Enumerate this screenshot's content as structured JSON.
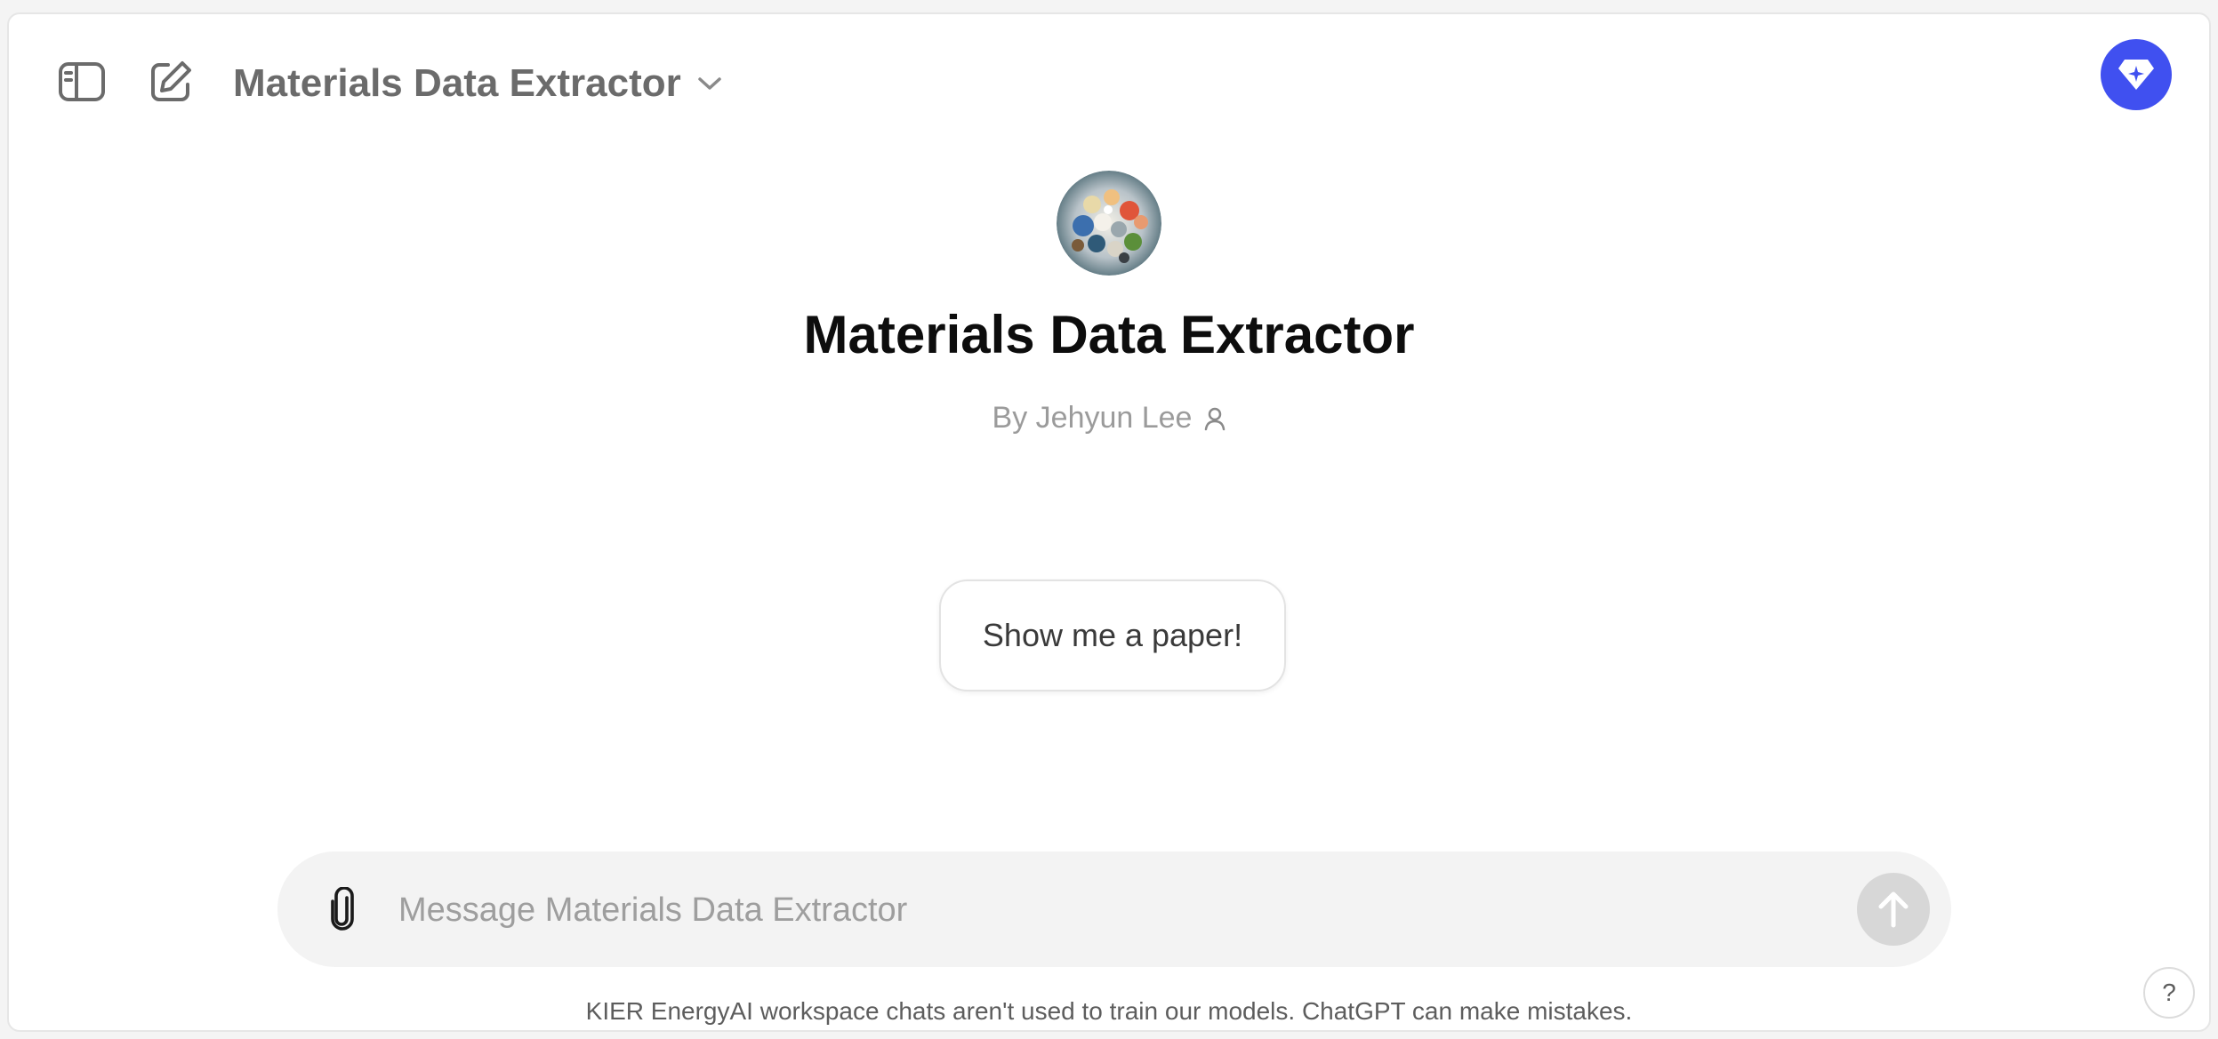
{
  "header": {
    "model_title": "Materials Data Extractor",
    "icons": {
      "sidebar_toggle": "sidebar-toggle-icon",
      "new_chat": "edit-icon",
      "model_dropdown": "chevron-down-icon",
      "profile": "diamond-sparkle-icon"
    }
  },
  "gpt": {
    "name": "Materials Data Extractor",
    "author": "By Jehyun Lee",
    "author_icon": "person-icon"
  },
  "conversation_starters": [
    "Show me a paper!"
  ],
  "composer": {
    "placeholder": "Message Materials Data Extractor",
    "attach_icon": "paperclip-icon",
    "send_icon": "arrow-up-icon"
  },
  "footer": {
    "note": "KIER EnergyAI workspace chats aren't used to train our models. ChatGPT can make mistakes.",
    "help_label": "?"
  },
  "colors": {
    "accent": "#4050f0",
    "send_disabled": "#d7d7d7",
    "composer_bg": "#f3f3f3"
  }
}
